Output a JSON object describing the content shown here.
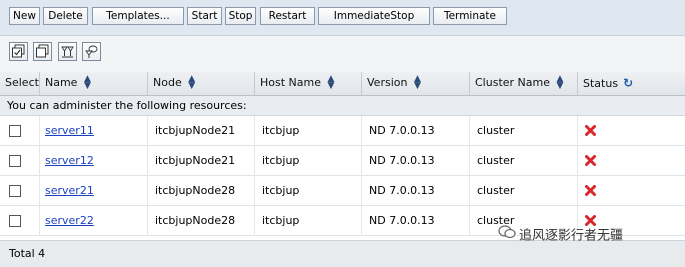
{
  "toolbar": {
    "buttons": [
      "New",
      "Delete",
      "Templates...",
      "Start",
      "Stop",
      "Restart",
      "ImmediateStop",
      "Terminate"
    ]
  },
  "icon_toolbar": {
    "icons": [
      "select-all-icon",
      "deselect-all-icon",
      "filter-icon",
      "show-filter-icon"
    ]
  },
  "table": {
    "columns": [
      "Select",
      "Name",
      "Node",
      "Host Name",
      "Version",
      "Cluster Name",
      "Status"
    ],
    "message": "You can administer the following resources:",
    "rows": [
      {
        "name": "server11",
        "node": "itcbjupNode21",
        "host": "itcbjup",
        "version": "ND 7.0.0.13",
        "cluster": "cluster",
        "status": "stopped"
      },
      {
        "name": "server12",
        "node": "itcbjupNode21",
        "host": "itcbjup",
        "version": "ND 7.0.0.13",
        "cluster": "cluster",
        "status": "stopped"
      },
      {
        "name": "server21",
        "node": "itcbjupNode28",
        "host": "itcbjup",
        "version": "ND 7.0.0.13",
        "cluster": "cluster",
        "status": "stopped"
      },
      {
        "name": "server22",
        "node": "itcbjupNode28",
        "host": "itcbjup",
        "version": "ND 7.0.0.13",
        "cluster": "cluster",
        "status": "stopped"
      }
    ],
    "total": "Total 4"
  },
  "watermark": {
    "text": "追风逐影行者无疆"
  },
  "colors": {
    "status_stopped": "#d9262b",
    "link": "#1a3fbf"
  }
}
